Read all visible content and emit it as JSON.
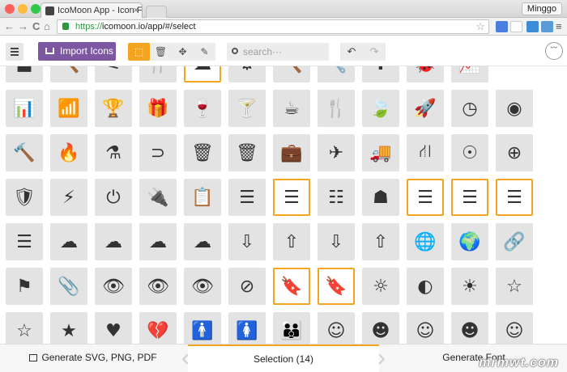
{
  "browser": {
    "tab_title": "IcoMoon App - Icon Font, S",
    "user": "Minggo",
    "url_scheme": "https://",
    "url_rest": "icomoon.io/app/#/select",
    "back_glyph": "←",
    "forward_glyph": "→",
    "reload_glyph": "C",
    "home_glyph": "⌂",
    "star_glyph": "☆",
    "menu_glyph": "≡"
  },
  "app": {
    "import_label": "Import Icons",
    "search_placeholder": "search···",
    "undo_glyph": "↶",
    "redo_glyph": "↷",
    "smiley_glyph": "˘˘"
  },
  "tools": [
    {
      "name": "select",
      "glyph": "⬚",
      "active": true
    },
    {
      "name": "delete",
      "glyph": "🗑",
      "active": false
    },
    {
      "name": "move",
      "glyph": "✥",
      "active": false
    },
    {
      "name": "edit",
      "glyph": "✎",
      "active": false
    }
  ],
  "icon_rows": [
    [
      "■",
      "🔨",
      "⚟",
      "🍴",
      "☁",
      "⚙",
      "🔨",
      "🔧",
      "✚",
      "🐞",
      "📈"
    ],
    [
      "📊",
      "📶",
      "🏆",
      "🎁",
      "🍷",
      "🍸",
      "☕",
      "🍴",
      "🍃",
      "🚀",
      "◷",
      "◉"
    ],
    [
      "🔨",
      "🔥",
      "⚗",
      "⊃",
      "🗑",
      "🗑",
      "💼",
      "✈",
      "🚚",
      "⛙",
      "☉",
      "⊕"
    ],
    [
      "🛡",
      "⚡",
      "⏻",
      "🔌",
      "📋",
      "☰",
      "☰",
      "☷",
      "☗",
      "☰",
      "☰",
      "☰"
    ],
    [
      "☰",
      "☁",
      "☁",
      "☁",
      "☁",
      "⇩",
      "⇧",
      "⇩",
      "⇧",
      "🌐",
      "🌍",
      "🔗"
    ],
    [
      "⚑",
      "📎",
      "👁",
      "👁",
      "👁",
      "⊘",
      "🔖",
      "🔖",
      "☼",
      "◐",
      "☀",
      "☆"
    ],
    [
      "☆",
      "★",
      "♥",
      "💔",
      "🚹",
      "🚺",
      "👪",
      "☺",
      "☻",
      "☺",
      "☻",
      "☺"
    ]
  ],
  "selected": [
    [
      0,
      4
    ],
    [
      3,
      6
    ],
    [
      3,
      9
    ],
    [
      3,
      10
    ],
    [
      3,
      11
    ],
    [
      5,
      6
    ],
    [
      5,
      7
    ]
  ],
  "footer": {
    "generate_label": "Generate SVG, PNG, PDF",
    "selection_label": "Selection (14)",
    "font_label": "Generate Font",
    "chevron_left": "‹",
    "chevron_right": "›",
    "watermark": "mrmwt.com"
  },
  "colors": {
    "accent": "#f3a521",
    "import_purple": "#7e57a3",
    "cell_bg": "#e3e3e3",
    "icon": "#333333"
  }
}
